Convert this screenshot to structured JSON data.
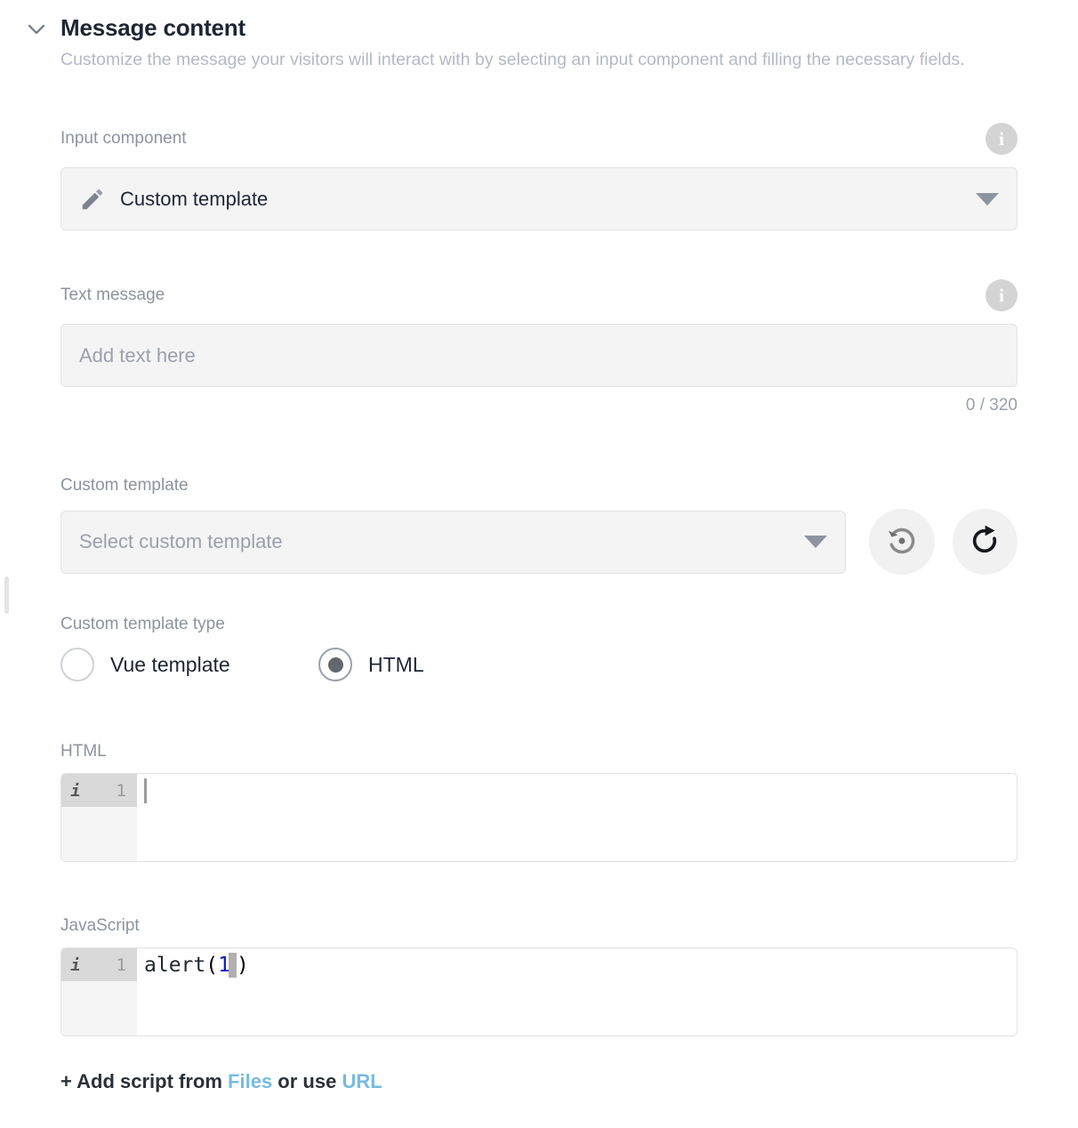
{
  "section": {
    "collapse_icon": "chevron-down-icon",
    "title": "Message content",
    "description": "Customize the message your visitors will interact with by selecting an input component and filling the necessary fields."
  },
  "input_component": {
    "label": "Input component",
    "info_icon": "info-icon",
    "icon": "pencil-icon",
    "value": "Custom template",
    "caret_icon": "caret-down-icon"
  },
  "text_message": {
    "label": "Text message",
    "info_icon": "info-icon",
    "placeholder": "Add text here",
    "value": "",
    "counter": "0 / 320"
  },
  "custom_template": {
    "label": "Custom template",
    "placeholder": "Select custom template",
    "value": "",
    "caret_icon": "caret-down-icon",
    "restore_button": {
      "icon": "restore-history-icon",
      "title": "Restore"
    },
    "refresh_button": {
      "icon": "refresh-icon",
      "title": "Refresh"
    }
  },
  "custom_template_type": {
    "label": "Custom template type",
    "options": [
      {
        "label": "Vue template",
        "checked": false
      },
      {
        "label": "HTML",
        "checked": true
      }
    ]
  },
  "html_editor": {
    "label": "HTML",
    "gutter_marker": "i",
    "line_number": "1",
    "code": ""
  },
  "js_editor": {
    "label": "JavaScript",
    "gutter_marker": "i",
    "line_number": "1",
    "code": "alert(1)",
    "tokens": {
      "fn": "alert",
      "open_paren": "(",
      "number": "1",
      "close_paren": ")"
    }
  },
  "add_script": {
    "prefix": "+ Add script from ",
    "files_link": "Files",
    "middle": " or use ",
    "url_link": "URL"
  },
  "colors": {
    "link": "#77bbe0",
    "field_bg": "#f4f4f5",
    "label": "#8d939f",
    "title": "#1e2533",
    "code_number": "#0a16c8"
  }
}
